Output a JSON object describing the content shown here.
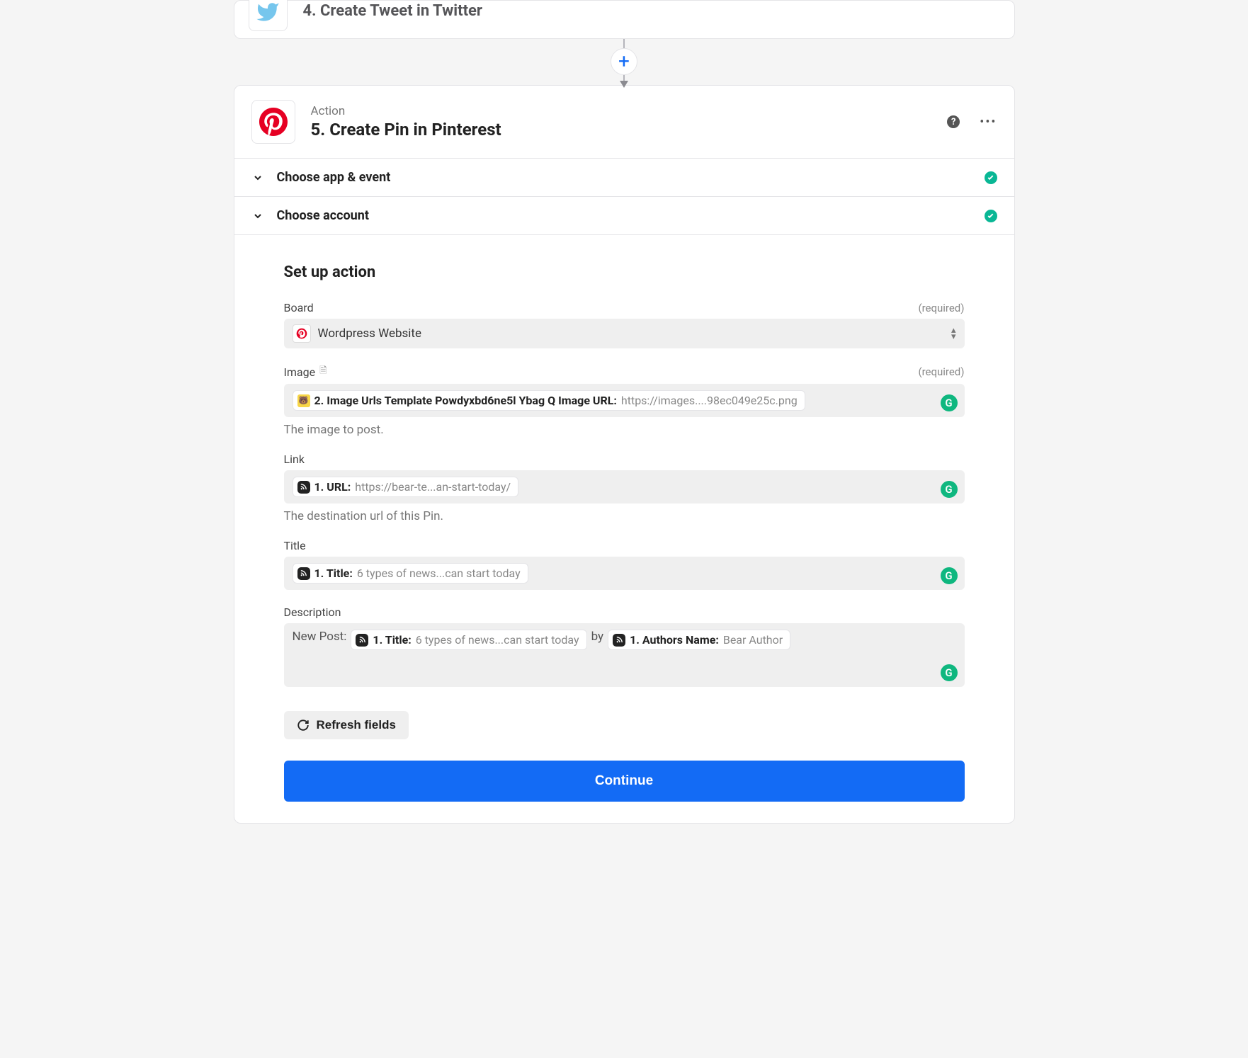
{
  "previous_step": {
    "title": "4. Create Tweet in Twitter"
  },
  "step": {
    "subtitle": "Action",
    "title": "5. Create Pin in Pinterest",
    "sections": {
      "choose_app_event": "Choose app & event",
      "choose_account": "Choose account",
      "setup_action": "Set up action"
    }
  },
  "fields": {
    "board": {
      "label": "Board",
      "required": "(required)",
      "value": "Wordpress Website"
    },
    "image": {
      "label": "Image",
      "required": "(required)",
      "pill_label": "2. Image Urls Template Powdyxbd6ne5l Ybag Q Image URL:",
      "pill_value": "https://images....98ec049e25c.png",
      "help": "The image to post."
    },
    "link": {
      "label": "Link",
      "pill_label": "1. URL:",
      "pill_value": "https://bear-te...an-start-today/",
      "help": "The destination url of this Pin."
    },
    "title": {
      "label": "Title",
      "pill_label": "1. Title:",
      "pill_value": "6 types of news...can start today"
    },
    "description": {
      "label": "Description",
      "prefix": "New Post:",
      "pill1_label": "1. Title:",
      "pill1_value": "6 types of news...can start today",
      "mid": "by",
      "pill2_label": "1. Authors Name:",
      "pill2_value": "Bear Author"
    }
  },
  "buttons": {
    "refresh": "Refresh fields",
    "continue": "Continue"
  }
}
